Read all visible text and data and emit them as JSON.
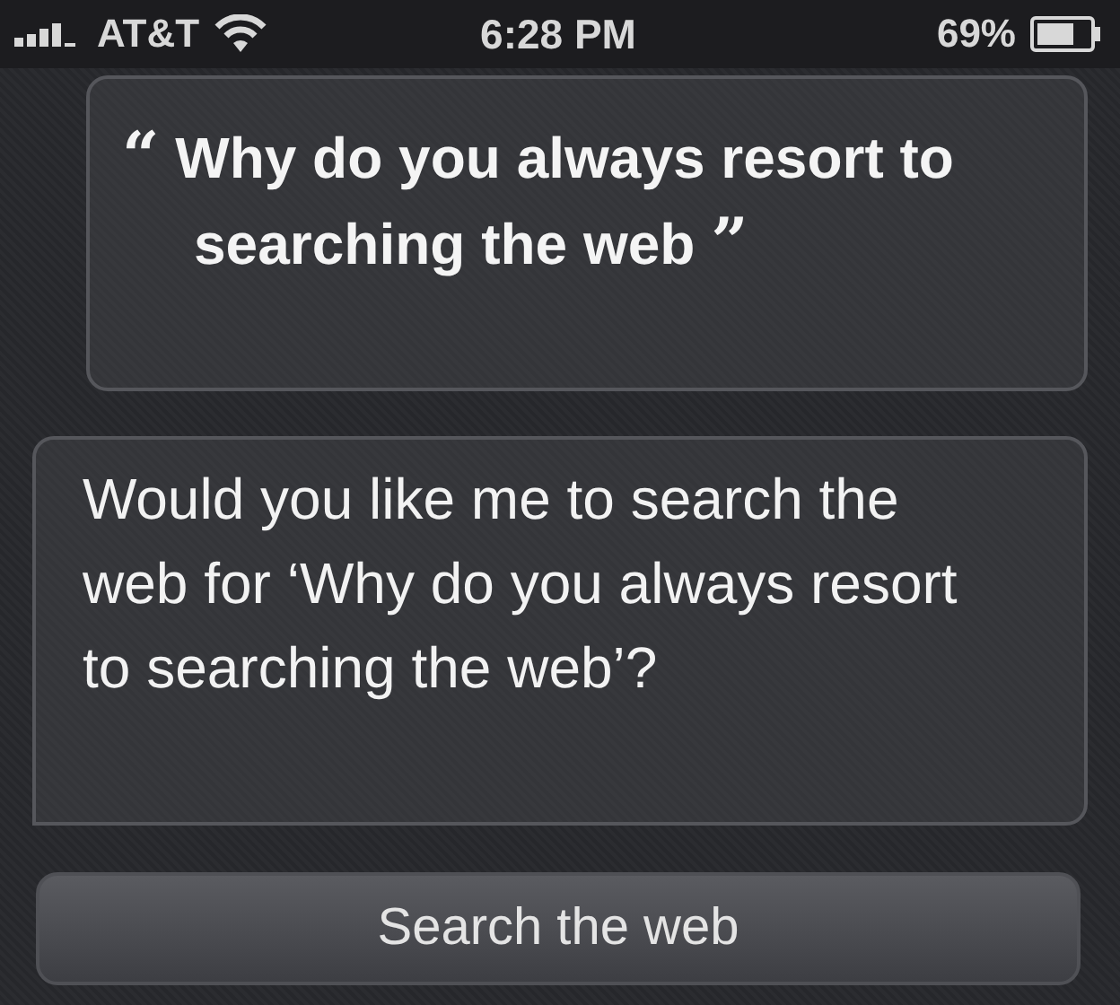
{
  "status_bar": {
    "carrier": "AT&T",
    "time": "6:28 PM",
    "battery": "69%"
  },
  "user_query": {
    "open_quote": "“",
    "text": "Why do you always resort to searching the web",
    "close_quote": "”"
  },
  "reply": "Would you like me to search the web for ‘Why do you always resort to searching the web’?",
  "action_button": "Search the web"
}
